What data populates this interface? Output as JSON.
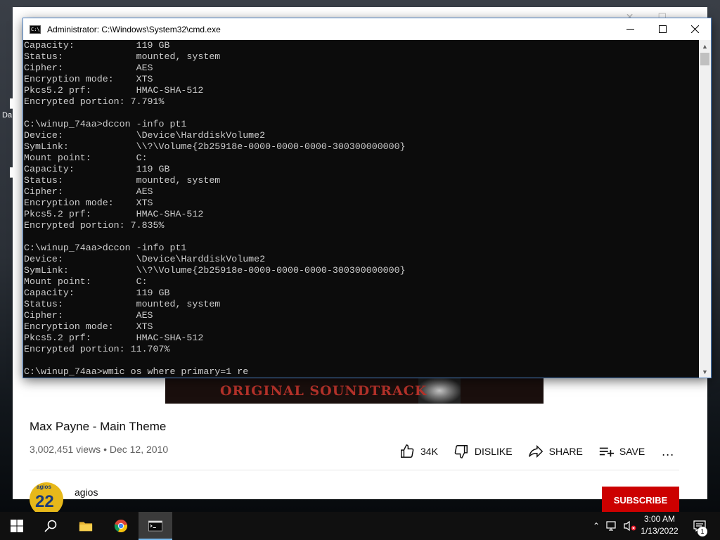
{
  "desktop": {
    "partial_label": "Da"
  },
  "browser": {
    "video_banner_text": "ORIGINAL SOUNDTRACK",
    "video_title": "Max Payne - Main Theme",
    "video_meta": "3,002,451 views • Dec 12, 2010",
    "actions": {
      "like_count": "34K",
      "dislike_label": "DISLIKE",
      "share_label": "SHARE",
      "save_label": "SAVE",
      "more_label": "..."
    },
    "channel": {
      "name": "agios",
      "avatar_top": "agios",
      "avatar_big": "22"
    },
    "subscribe_label": "SUBSCRIBE"
  },
  "cmd": {
    "title": "Administrator: C:\\Windows\\System32\\cmd.exe",
    "lines": [
      "Capacity:           119 GB",
      "Status:             mounted, system",
      "Cipher:             AES",
      "Encryption mode:    XTS",
      "Pkcs5.2 prf:        HMAC-SHA-512",
      "Encrypted portion: 7.791%",
      "",
      "C:\\winup_74aa>dccon -info pt1",
      "Device:             \\Device\\HarddiskVolume2",
      "SymLink:            \\\\?\\Volume{2b25918e-0000-0000-0000-300300000000}",
      "Mount point:        C:",
      "Capacity:           119 GB",
      "Status:             mounted, system",
      "Cipher:             AES",
      "Encryption mode:    XTS",
      "Pkcs5.2 prf:        HMAC-SHA-512",
      "Encrypted portion: 7.835%",
      "",
      "C:\\winup_74aa>dccon -info pt1",
      "Device:             \\Device\\HarddiskVolume2",
      "SymLink:            \\\\?\\Volume{2b25918e-0000-0000-0000-300300000000}",
      "Mount point:        C:",
      "Capacity:           119 GB",
      "Status:             mounted, system",
      "Cipher:             AES",
      "Encryption mode:    XTS",
      "Pkcs5.2 prf:        HMAC-SHA-512",
      "Encrypted portion: 11.707%",
      "",
      "C:\\winup_74aa>wmic os where primary=1 re"
    ]
  },
  "taskbar": {
    "clock_time": "3:00 AM",
    "clock_date": "1/13/2022",
    "notification_count": "1"
  },
  "icons": {
    "start": "windows-logo-icon",
    "search": "search-icon",
    "explorer": "folder-icon",
    "chrome": "chrome-icon",
    "cmd": "terminal-icon"
  },
  "colors": {
    "terminal_bg": "#0c0c0c",
    "terminal_text": "#cccccc",
    "subscribe_red": "#cc0000",
    "taskbar_bg": "#101010",
    "taskbar_accent": "#76b9ed"
  }
}
